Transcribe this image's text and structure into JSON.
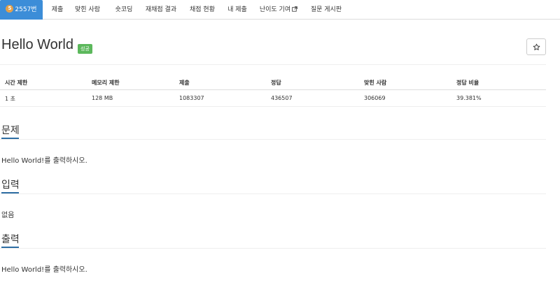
{
  "tabs": [
    {
      "label": "2557번",
      "level": "5",
      "active": true
    },
    {
      "label": "제출"
    },
    {
      "label": "맞힌 사람"
    },
    {
      "label": "숏코딩"
    },
    {
      "label": "재채점 결과"
    },
    {
      "label": "채점 현황"
    },
    {
      "label": "내 제출"
    },
    {
      "label": "난이도 기여",
      "icon": "external-link-icon"
    },
    {
      "label": "질문 게시판"
    }
  ],
  "problem": {
    "title": "Hello World",
    "status_badge": "성공",
    "star_icon": "star-icon"
  },
  "info_table": {
    "headers": [
      "시간 제한",
      "메모리 제한",
      "제출",
      "정답",
      "맞힌 사람",
      "정답 비율"
    ],
    "row": [
      "1 초",
      "128 MB",
      "1083307",
      "436507",
      "306069",
      "39.381%"
    ]
  },
  "sections": [
    {
      "title": "문제",
      "body": "Hello World!를 출력하시오."
    },
    {
      "title": "입력",
      "body": "없음"
    },
    {
      "title": "출력",
      "body": "Hello World!를 출력하시오."
    }
  ],
  "colors": {
    "active_tab": "#3c8dd8",
    "success_badge": "#5cb85c",
    "section_accent": "#2d6da3",
    "level_badge": "#e3a04a"
  }
}
